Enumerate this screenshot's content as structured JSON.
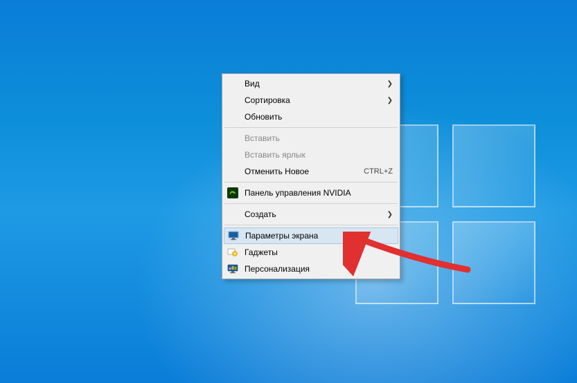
{
  "context_menu": {
    "items": [
      {
        "label": "Вид",
        "has_submenu": true
      },
      {
        "label": "Сортировка",
        "has_submenu": true
      },
      {
        "label": "Обновить"
      },
      {
        "label": "Вставить",
        "disabled": true
      },
      {
        "label": "Вставить ярлык",
        "disabled": true
      },
      {
        "label": "Отменить Новое",
        "shortcut": "CTRL+Z"
      },
      {
        "label": "Панель управления NVIDIA",
        "icon": "nvidia"
      },
      {
        "label": "Создать",
        "has_submenu": true
      },
      {
        "label": "Параметры экрана",
        "icon": "monitor",
        "highlighted": true
      },
      {
        "label": "Гаджеты",
        "icon": "gadgets"
      },
      {
        "label": "Персонализация",
        "icon": "personalize"
      }
    ]
  },
  "annotations": {
    "arrow_color": "#e03030",
    "highlight_color": "#d8e6f2"
  }
}
